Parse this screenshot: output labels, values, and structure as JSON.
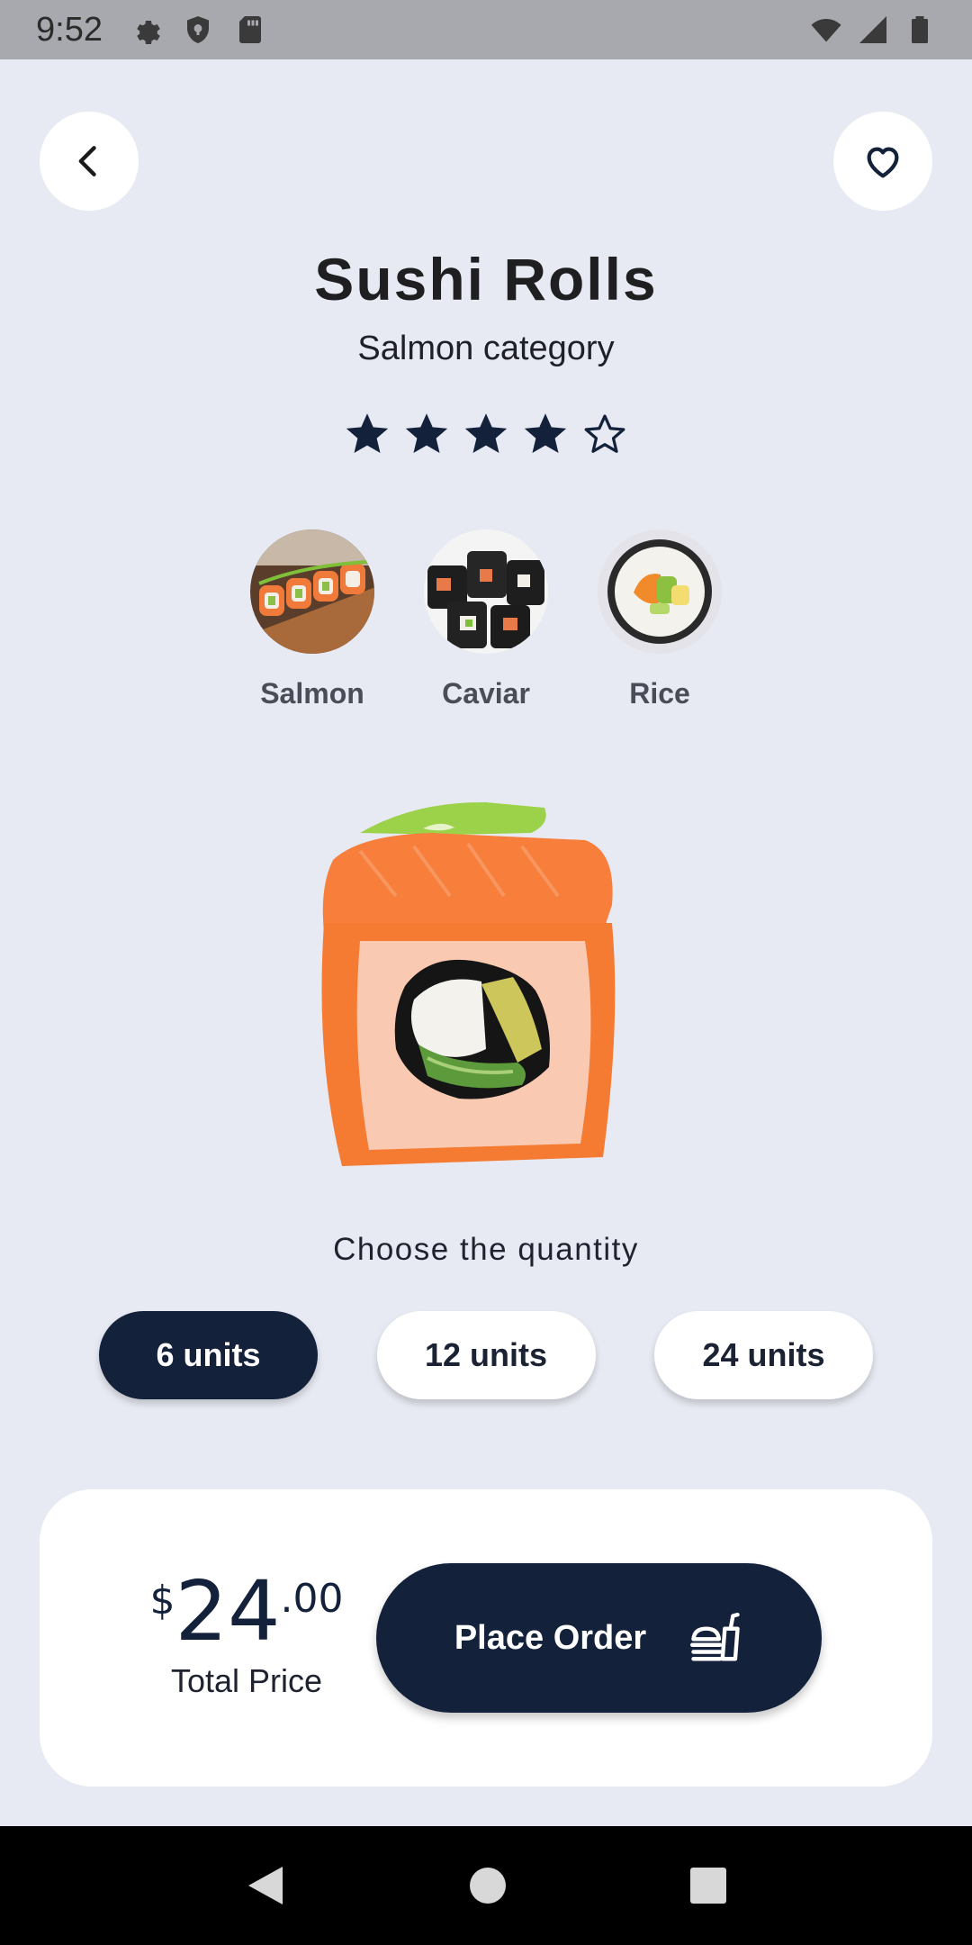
{
  "status_bar": {
    "time": "9:52",
    "left_icons": [
      "settings-icon",
      "shield-icon",
      "sd-card-icon"
    ],
    "right_icons": [
      "wifi-icon",
      "signal-icon",
      "battery-icon"
    ]
  },
  "header": {
    "back_icon": "chevron-left-icon",
    "favorite_icon": "heart-outline-icon"
  },
  "product": {
    "title": "Sushi Rolls",
    "subtitle": "Salmon category",
    "rating": 4,
    "rating_max": 5
  },
  "ingredients": [
    {
      "label": "Salmon"
    },
    {
      "label": "Caviar"
    },
    {
      "label": "Rice"
    }
  ],
  "quantity": {
    "label": "Choose the quantity",
    "options": [
      "6 units",
      "12 units",
      "24 units"
    ],
    "selected": "6 units"
  },
  "order": {
    "currency": "$",
    "price_main": "24",
    "price_cents": ".00",
    "price_caption": "Total Price",
    "button_label": "Place Order",
    "button_icon": "food-tray-icon"
  },
  "nav_bar": {
    "icons": [
      "back-triangle-icon",
      "home-circle-icon",
      "recents-square-icon"
    ]
  },
  "colors": {
    "background": "#e8eaf3",
    "primary_dark": "#13213a",
    "card": "#ffffff"
  }
}
